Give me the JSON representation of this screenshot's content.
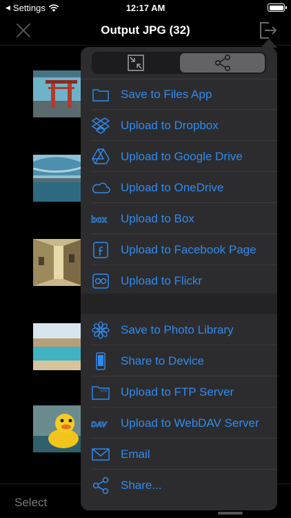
{
  "status_bar": {
    "back_label": "Settings",
    "time": "12:17 AM"
  },
  "nav": {
    "title": "Output JPG (32)",
    "close_icon": "close-x-icon",
    "export_icon": "export-icon"
  },
  "toolbar": {
    "select_label": "Select"
  },
  "popover": {
    "segments": [
      {
        "icon": "compress-icon",
        "selected": false
      },
      {
        "icon": "share-icon",
        "selected": true
      }
    ],
    "group1": [
      {
        "label": "Save to Files App",
        "icon": "folder-icon"
      },
      {
        "label": "Upload to Dropbox",
        "icon": "dropbox-icon"
      },
      {
        "label": "Upload to Google Drive",
        "icon": "google-drive-icon"
      },
      {
        "label": "Upload to OneDrive",
        "icon": "onedrive-cloud-icon"
      },
      {
        "label": "Upload to Box",
        "icon": "box-icon"
      },
      {
        "label": "Upload to Facebook Page",
        "icon": "facebook-icon"
      },
      {
        "label": "Upload to Flickr",
        "icon": "flickr-icon"
      }
    ],
    "group2": [
      {
        "label": "Save to Photo Library",
        "icon": "photos-flower-icon"
      },
      {
        "label": "Share to Device",
        "icon": "phone-device-icon"
      },
      {
        "label": "Upload to FTP Server",
        "icon": "ftp-folder-icon"
      },
      {
        "label": "Upload to WebDAV Server",
        "icon": "webdav-icon"
      },
      {
        "label": "Email",
        "icon": "mail-envelope-icon"
      },
      {
        "label": "Share...",
        "icon": "share-icon"
      }
    ]
  },
  "colors": {
    "accent": "#2f8bf0",
    "popover_bg": "#2c2c2e",
    "background": "#000000"
  }
}
